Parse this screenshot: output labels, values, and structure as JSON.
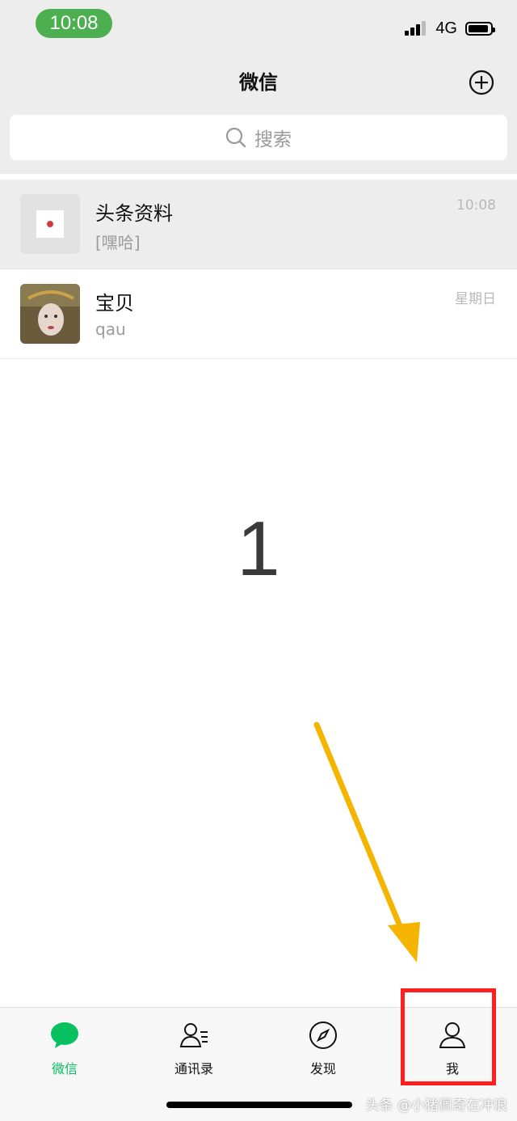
{
  "status_bar": {
    "time": "10:08",
    "network": "4G"
  },
  "nav": {
    "title": "微信"
  },
  "search": {
    "placeholder": "搜索"
  },
  "chats": [
    {
      "name": "头条资料",
      "preview": "[嘿哈]",
      "time": "10:08"
    },
    {
      "name": "宝贝",
      "preview": "qau",
      "time": "星期日"
    }
  ],
  "overlay": {
    "number": "1",
    "watermark": "头条 @小猪佩奇在冲浪"
  },
  "tabbar": {
    "items": [
      {
        "label": "微信",
        "icon": "chat-bubble-icon",
        "active": true
      },
      {
        "label": "通讯录",
        "icon": "contacts-icon",
        "active": false
      },
      {
        "label": "发现",
        "icon": "compass-icon",
        "active": false
      },
      {
        "label": "我",
        "icon": "person-icon",
        "active": false
      }
    ]
  },
  "colors": {
    "accent": "#07c160",
    "highlight_box": "#ff1f1f",
    "arrow": "#f5b400",
    "time_pill": "#4caf50"
  }
}
